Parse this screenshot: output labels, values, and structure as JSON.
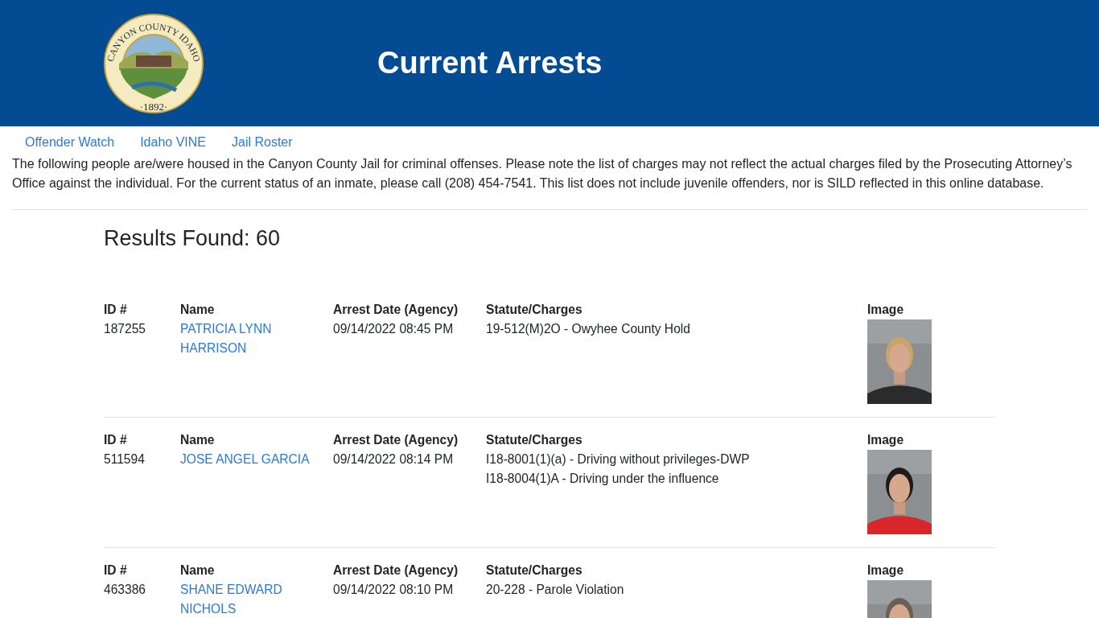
{
  "header": {
    "title": "Current Arrests",
    "seal": {
      "ring_text": "CANYON COUNTY IDAHO",
      "year": "·1892·"
    }
  },
  "nav": [
    {
      "label": "Offender Watch"
    },
    {
      "label": "Idaho VINE"
    },
    {
      "label": "Jail Roster"
    }
  ],
  "notice": "The following people are/were housed in the Canyon County Jail for criminal offenses. Please note the list of charges may not reflect the actual charges filed by the Prosecuting Attorney’s Office against the individual. For the current status of an inmate, please call (208) 454-7541. This list does not include juvenile offenders, nor is SILD reflected in this online database.",
  "results_heading": "Results Found: 60",
  "records": [
    {
      "labels": [
        "ID #",
        "Name",
        "Arrest Date (Agency)",
        "Statute/Charges",
        "Image"
      ],
      "id": "187255",
      "name": "PATRICIA LYNN HARRISON",
      "arrest_date": "09/14/2022 08:45 PM",
      "charges": [
        "19-512(M)2O - Owyhee County Hold"
      ],
      "image": {
        "kind": "picture"
      }
    },
    {
      "labels": [
        "ID #",
        "Name",
        "Arrest Date (Agency)",
        "Statute/Charges",
        "Image"
      ],
      "id": "511594",
      "name": "JOSE ANGEL GARCIA",
      "arrest_date": "09/14/2022 08:14 PM",
      "charges": [
        "I18-8001(1)(a) - Driving without privileges-DWP",
        "I18-8004(1)A - Driving under the influence"
      ],
      "image": {
        "kind": "picture"
      }
    },
    {
      "labels": [
        "ID #",
        "Name",
        "Arrest Date (Agency)",
        "Statute/Charges",
        "Image"
      ],
      "id": "463386",
      "name": "SHANE EDWARD NICHOLS",
      "arrest_date": "09/14/2022 08:10 PM",
      "charges": [
        "20-228 - Parole Violation"
      ],
      "image": {
        "kind": "picture"
      }
    }
  ]
}
